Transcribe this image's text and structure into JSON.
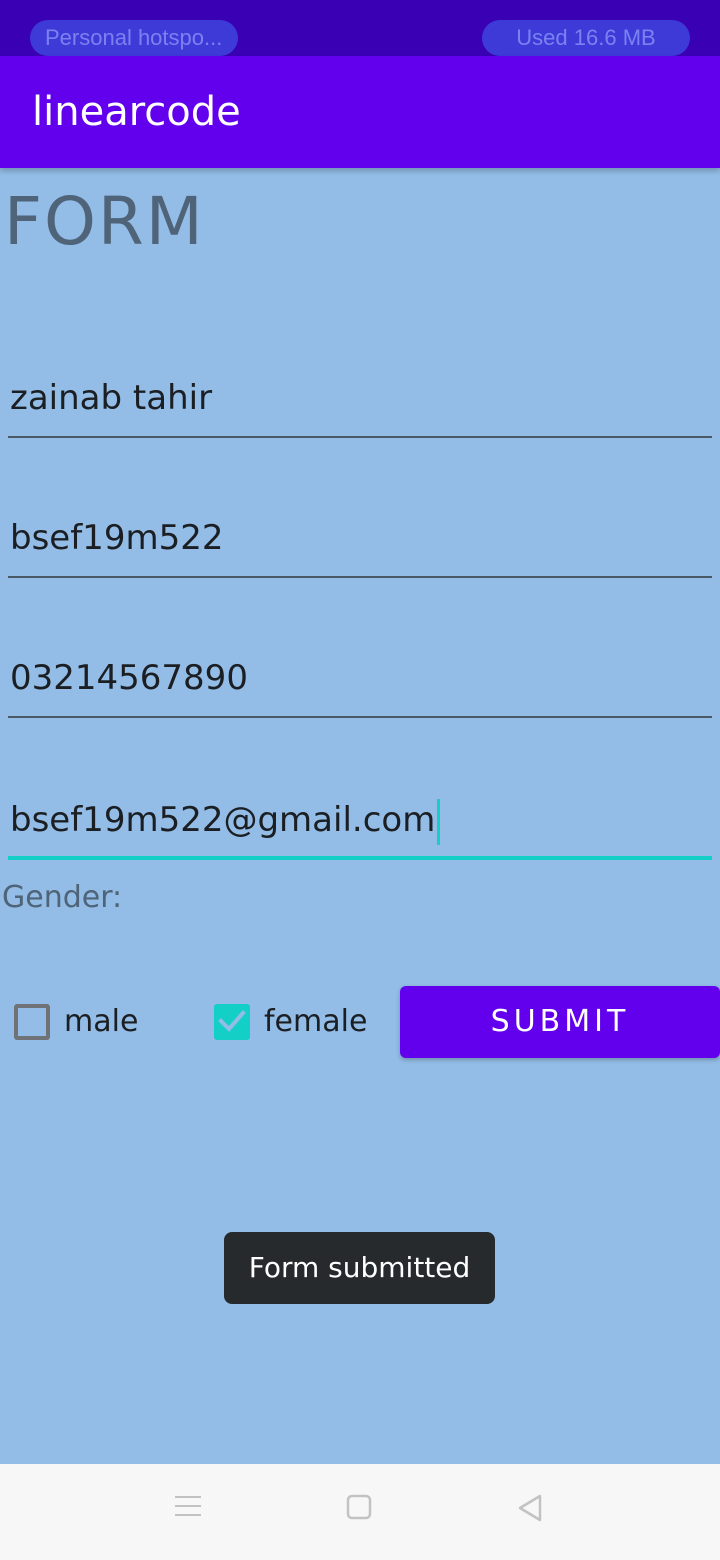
{
  "status_bar": {
    "hotspot_label": "Personal hotspo...",
    "data_usage": "Used  16.6 MB"
  },
  "app_bar": {
    "title": "linearcode"
  },
  "form": {
    "heading": "FORM",
    "fields": [
      {
        "value": "zainab tahir"
      },
      {
        "value": "bsef19m522"
      },
      {
        "value": "03214567890"
      },
      {
        "value": "bsef19m522@gmail.com",
        "focused": true
      }
    ],
    "gender_label": "Gender:",
    "gender_options": [
      {
        "label": "male",
        "checked": false
      },
      {
        "label": "female",
        "checked": true
      }
    ],
    "submit_label": "SUBMIT"
  },
  "toast": {
    "message": "Form submitted"
  },
  "nav_bar": {
    "icons": [
      "menu-icon",
      "home-icon",
      "back-icon"
    ]
  },
  "colors": {
    "background": "#93bde6",
    "primary": "#6200ee",
    "status_bar": "#3a00b4",
    "accent": "#13cfc6",
    "toast": "#272a2d"
  }
}
